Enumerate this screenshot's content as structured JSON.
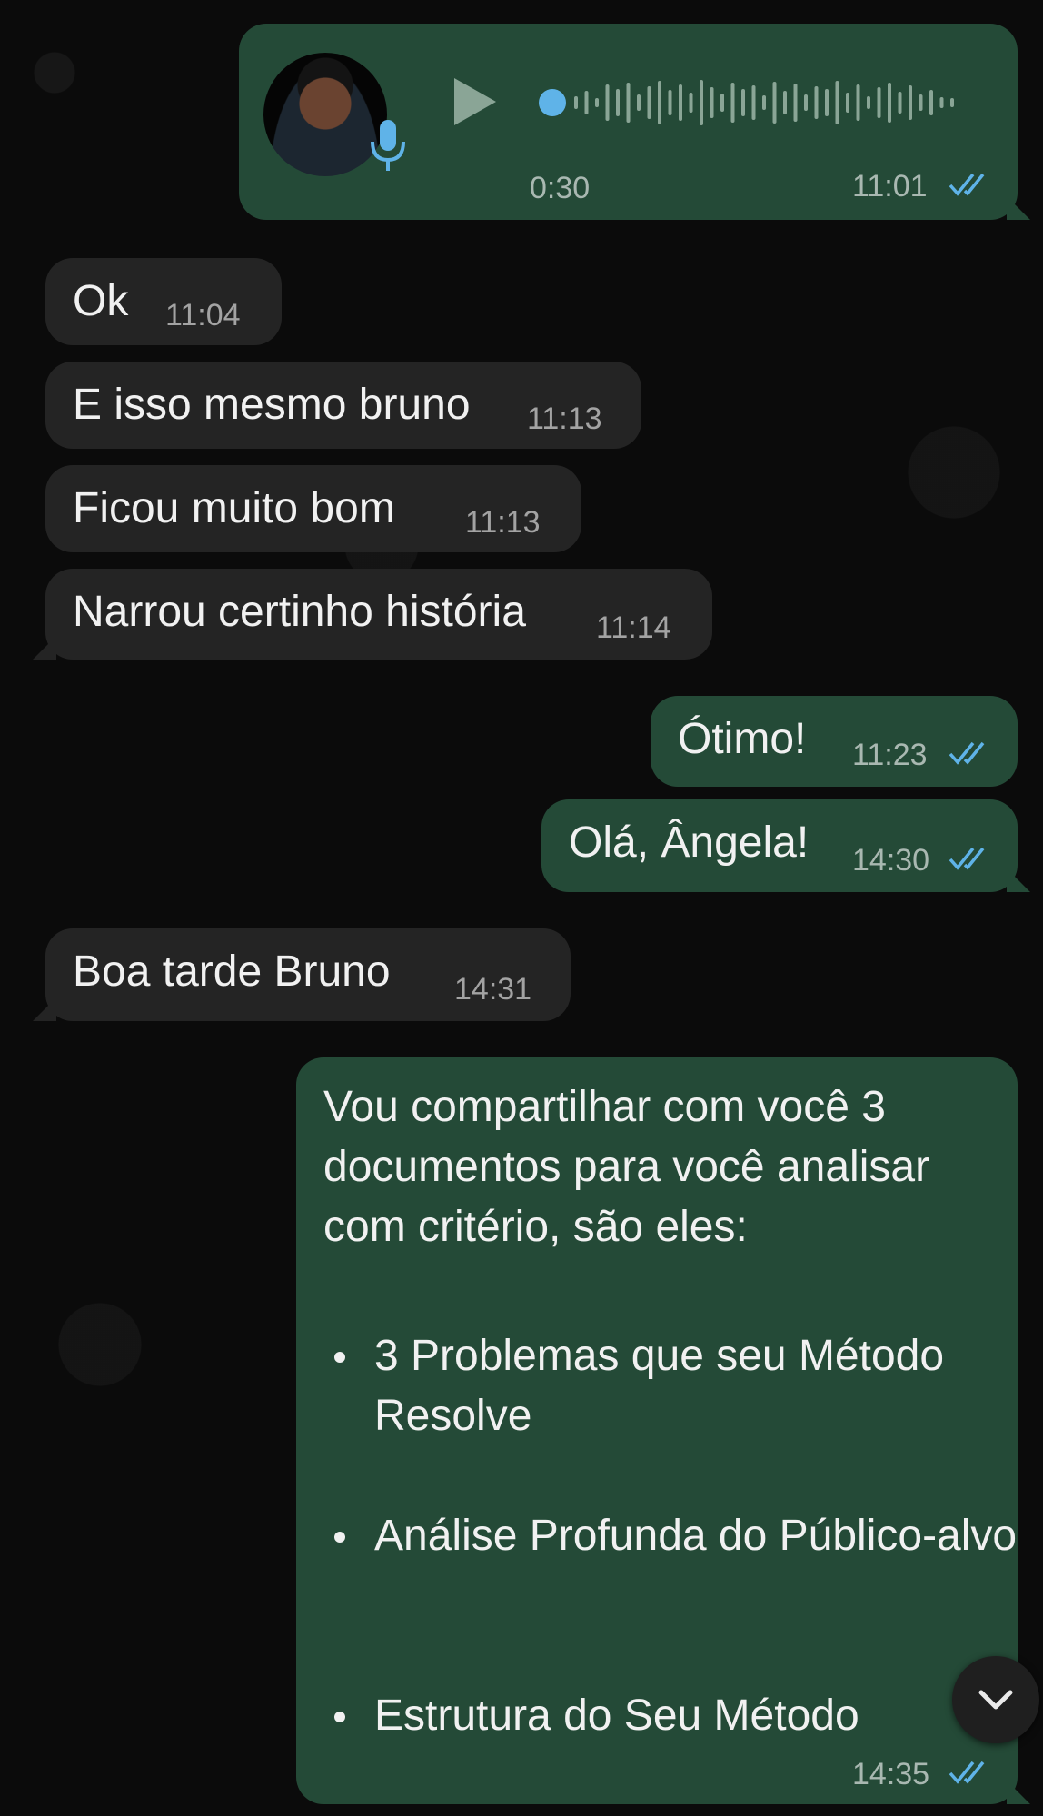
{
  "messages": {
    "voice": {
      "duration": "0:30",
      "time": "11:01"
    },
    "m1": {
      "text": "Ok",
      "time": "11:04"
    },
    "m2": {
      "text": "E isso mesmo bruno",
      "time": "11:13"
    },
    "m3": {
      "text": "Ficou muito  bom",
      "time": "11:13"
    },
    "m4": {
      "text": "Narrou certinho história",
      "time": "11:14"
    },
    "m5": {
      "text": "Ótimo!",
      "time": "11:23"
    },
    "m6": {
      "text": "Olá, Ângela!",
      "time": "14:30"
    },
    "m7": {
      "text": "Boa tarde  Bruno",
      "time": "14:31"
    },
    "m8": {
      "intro": "Vou compartilhar com você 3 documentos para você analisar com critério, são eles:",
      "items": [
        "3 Problemas que seu Método Resolve",
        "Análise Profunda do Público-alvo",
        "Estrutura do Seu Método"
      ],
      "time": "14:35"
    }
  },
  "colors": {
    "incoming_bubble": "#242424",
    "outgoing_bubble": "#244a37",
    "read_ticks": "#5fb3e8",
    "background": "#0b0b0b"
  },
  "icons": [
    "play-icon",
    "mic-icon",
    "double-check-icon",
    "chevron-down-icon"
  ]
}
